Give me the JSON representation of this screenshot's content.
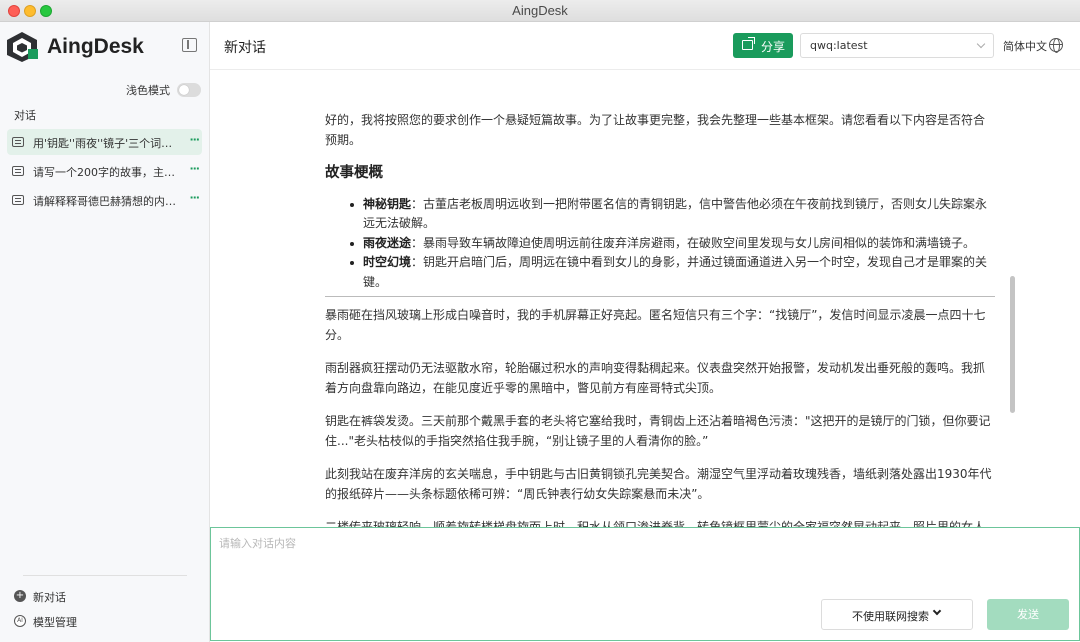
{
  "window": {
    "title": "AingDesk"
  },
  "sidebar": {
    "brand": "AingDesk",
    "theme_label": "浅色模式",
    "section_label": "对话",
    "conversations": [
      {
        "title": "用'钥匙''雨夜''镜子'三个词编一",
        "active": true
      },
      {
        "title": "请写一个200字的故事，主角...",
        "active": false
      },
      {
        "title": "请解释释哥德巴赫猜想的内容，...",
        "active": false
      }
    ],
    "more_label": "···",
    "new_chat_label": "新对话",
    "model_manage_label": "模型管理",
    "new_chat_icon": "plus-circle-icon",
    "model_manage_icon": "ai-icon"
  },
  "header": {
    "title": "新对话",
    "share_label": "分享",
    "model_value": "qwq:latest",
    "language_label": "简体中文"
  },
  "message": {
    "intro": "好的，我将按照您的要求创作一个悬疑短篇故事。为了让故事更完整，我会先整理一些基本框架。请您看看以下内容是否符合预期。",
    "heading": "故事梗概",
    "bullets": [
      {
        "term": "神秘钥匙",
        "text": "：古董店老板周明远收到一把附带匿名信的青铜钥匙，信中警告他必须在午夜前找到镜厅，否则女儿失踪案永远无法破解。"
      },
      {
        "term": "雨夜迷途",
        "text": "：暴雨导致车辆故障迫使周明远前往废弃洋房避雨，在破败空间里发现与女儿房间相似的装饰和满墙镜子。"
      },
      {
        "term": "时空幻境",
        "text": "：钥匙开启暗门后，周明远在镜中看到女儿的身影，并通过镜面通道进入另一个时空，发现自己才是罪案的关键。"
      }
    ],
    "paragraphs": [
      "暴雨砸在挡风玻璃上形成白噪音时，我的手机屏幕正好亮起。匿名短信只有三个字：“找镜厅”，发信时间显示凌晨一点四十七分。",
      "雨刮器疯狂摆动仍无法驱散水帘，轮胎碾过积水的声响变得黏稠起来。仪表盘突然开始报警，发动机发出垂死般的轰鸣。我抓着方向盘靠向路边，在能见度近乎零的黑暗中，瞥见前方有座哥特式尖顶。",
      "钥匙在裤袋发烫。三天前那个戴黑手套的老头将它塞给我时，青铜齿上还沾着暗褐色污渍：\"这把开的是镜厅的门锁，但你要记住...\"老头枯枝似的手指突然掐住我手腕，“别让镜子里的人看清你的脸。”",
      "此刻我站在废弃洋房的玄关喘息，手中钥匙与古旧黄铜锁孔完美契合。潮湿空气里浮动着玫瑰残香，墙纸剥落处露出1930年代的报纸碎片——头条标题依稀可辨：“周氏钟表行幼女失踪案悬而未决”。",
      "二楼传来玻璃轻响。顺着旋转楼梯盘旋而上时，积水从领口渗进脊背。转角镜框里蒙尘的全家福突然晃动起来，照片里的女人"
    ]
  },
  "composer": {
    "placeholder": "请输入对话内容",
    "search_label": "不使用联网搜索",
    "send_label": "发送"
  },
  "colors": {
    "accent": "#1a9b5c",
    "send_disabled": "#a3dcbf",
    "active_conversation": "#e3f1ea"
  }
}
